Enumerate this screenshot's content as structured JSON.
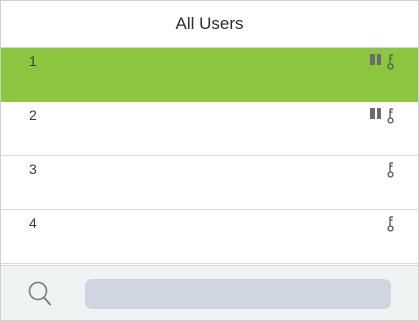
{
  "header": {
    "title": "All Users"
  },
  "users": [
    {
      "id": "1",
      "selected": true,
      "icons": [
        "card-icon",
        "key-icon"
      ]
    },
    {
      "id": "2",
      "selected": false,
      "icons": [
        "card-icon",
        "key-icon"
      ]
    },
    {
      "id": "3",
      "selected": false,
      "icons": [
        "key-icon"
      ]
    },
    {
      "id": "4",
      "selected": false,
      "icons": [
        "key-icon"
      ]
    }
  ],
  "search": {
    "value": "",
    "placeholder": ""
  },
  "colors": {
    "selected_row": "#8cc63f",
    "search_bar_bg": "#eef3f3",
    "search_field_bg": "#cfd6e2"
  }
}
